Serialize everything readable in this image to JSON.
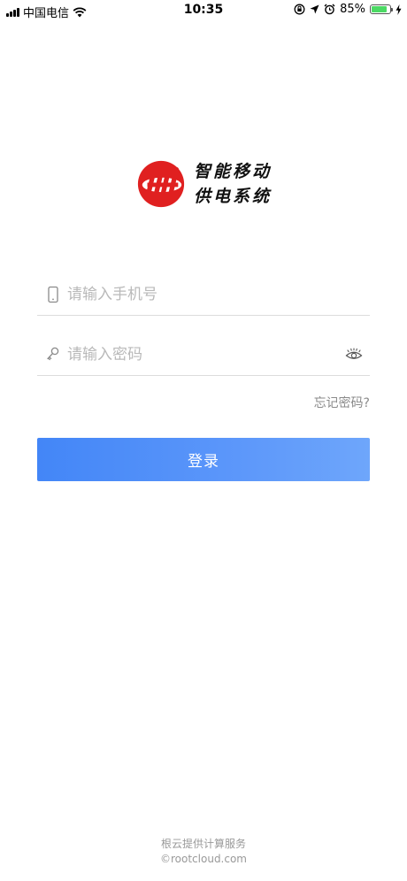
{
  "status_bar": {
    "carrier": "中国电信",
    "time": "10:35",
    "battery_percent": "85%",
    "battery_level": 0.85,
    "icons": [
      "signal-icon",
      "wifi-icon",
      "lock-rotation-icon",
      "location-icon",
      "alarm-icon",
      "battery-icon",
      "charging-icon"
    ]
  },
  "logo": {
    "line1": "智能移动",
    "line2": "供电系统",
    "brand_color": "#e02020"
  },
  "form": {
    "phone_placeholder": "请输入手机号",
    "phone_value": "",
    "password_placeholder": "请输入密码",
    "password_value": "",
    "forgot_label": "忘记密码?",
    "login_label": "登录",
    "accent_color": "#4386f7"
  },
  "footer": {
    "line1": "根云提供计算服务",
    "line2": "©rootcloud.com"
  }
}
